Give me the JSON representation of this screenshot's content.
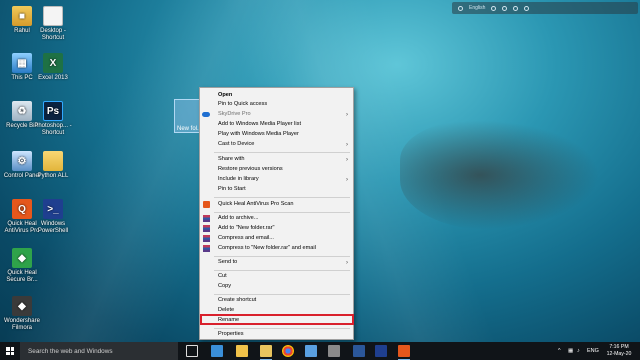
{
  "desktop_icons": [
    {
      "name": "rahul",
      "label": "Rahul"
    },
    {
      "name": "desktop-shortcut",
      "label": "Desktop - Shortcut"
    },
    {
      "name": "this-pc",
      "label": "This PC"
    },
    {
      "name": "excel-2013",
      "label": "Excel 2013"
    },
    {
      "name": "recycle-bin",
      "label": "Recycle Bin"
    },
    {
      "name": "photoshop-shortcut",
      "label": "Photoshop... - Shortcut"
    },
    {
      "name": "control-panel",
      "label": "Control Panel"
    },
    {
      "name": "python-all",
      "label": "Python ALL"
    },
    {
      "name": "quick-heal-antivirus-pro",
      "label": "Quick Heal AntiVirus Pro"
    },
    {
      "name": "windows-powershell",
      "label": "Windows PowerShell"
    },
    {
      "name": "quick-heal-secure-browser",
      "label": "Quick Heal Secure Br..."
    },
    {
      "name": "wondershare-filmora",
      "label": "Wondershare Filmora"
    }
  ],
  "selected_item": {
    "label": "New fol..."
  },
  "top_toolbar": {
    "lang": "English"
  },
  "context_menu": {
    "open": "Open",
    "pin_quick_access": "Pin to Quick access",
    "skydrive_pro": "SkyDrive Pro",
    "add_wmp_list": "Add to Windows Media Player list",
    "play_wmp": "Play with Windows Media Player",
    "cast_to_device": "Cast to Device",
    "share_with": "Share with",
    "restore_previous": "Restore previous versions",
    "include_in_library": "Include in library",
    "pin_to_start": "Pin to Start",
    "quick_heal_scan": "Quick Heal AntiVirus Pro Scan",
    "add_to_archive": "Add to archive...",
    "add_to_rar": "Add to \"New folder.rar\"",
    "compress_email": "Compress and email...",
    "compress_rar_email": "Compress to \"New folder.rar\" and email",
    "send_to": "Send to",
    "cut": "Cut",
    "copy": "Copy",
    "create_shortcut": "Create shortcut",
    "delete": "Delete",
    "rename": "Rename",
    "properties": "Properties"
  },
  "taskbar": {
    "search_placeholder": "Search the web and Windows",
    "language": "ENG",
    "time": "7:16 PM",
    "date": "12-May-20"
  }
}
